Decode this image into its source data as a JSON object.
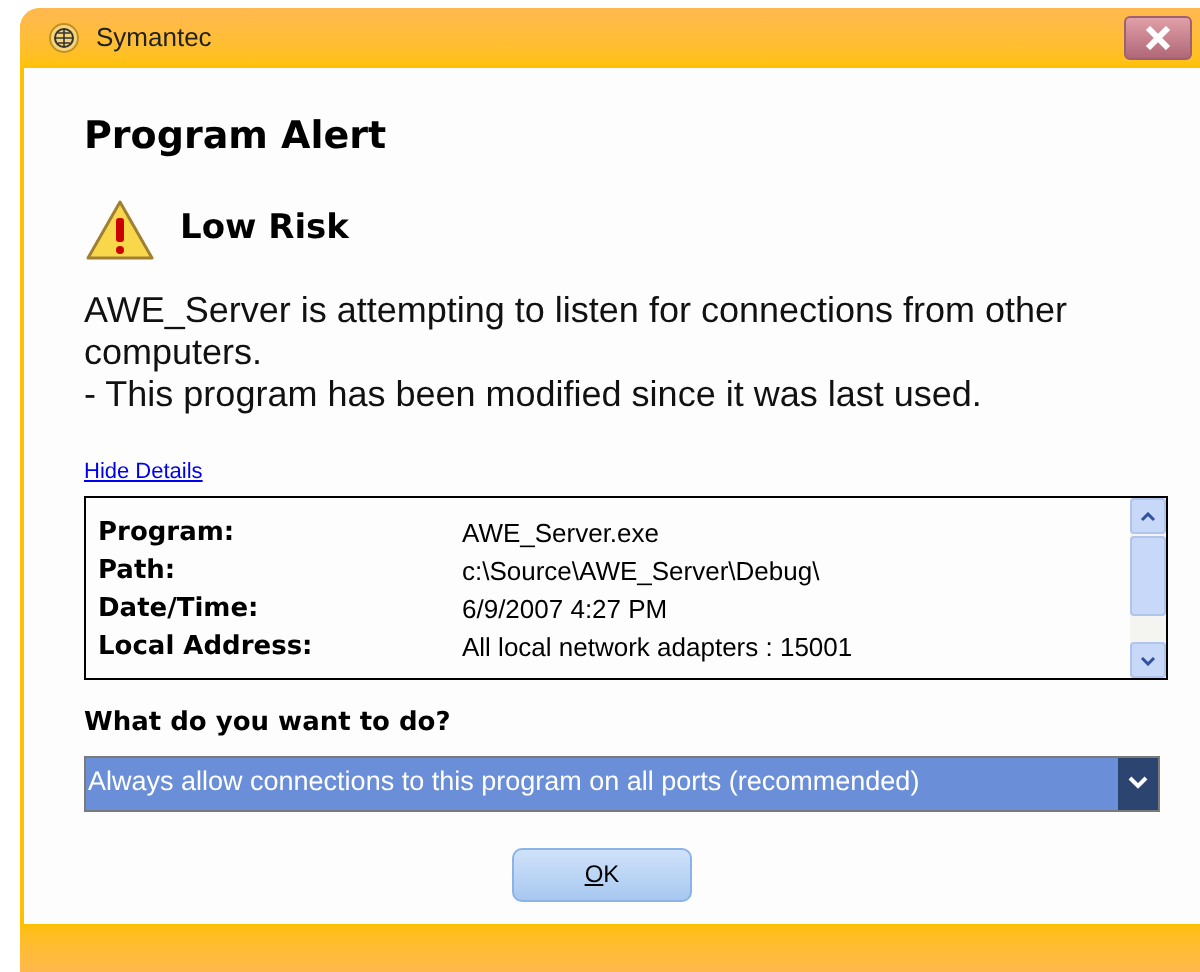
{
  "window": {
    "title": "Symantec"
  },
  "heading": "Program Alert",
  "risk": {
    "label": "Low Risk"
  },
  "message": [
    "AWE_Server is attempting to listen for connections from other computers.",
    "- This program has been modified since it was last used."
  ],
  "details_link": "Hide Details",
  "details": [
    {
      "label": "Program:",
      "value": "AWE_Server.exe"
    },
    {
      "label": "Path:",
      "value": "c:\\Source\\AWE_Server\\Debug\\"
    },
    {
      "label": "Date/Time:",
      "value": "6/9/2007 4:27 PM"
    },
    {
      "label": "Local Address:",
      "value": "All local network adapters : 15001"
    }
  ],
  "question": "What do you want to do?",
  "action_select": {
    "value": "Always allow connections to this program on all ports (recommended)"
  },
  "buttons": [
    "OK"
  ]
}
